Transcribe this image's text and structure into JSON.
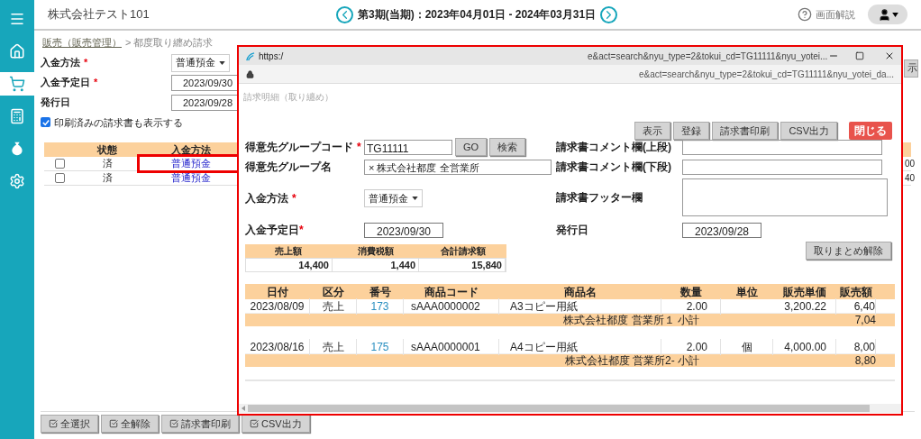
{
  "sidebar": {
    "items": [
      {
        "kind": "menu",
        "selected": false
      },
      {
        "kind": "home",
        "selected": false
      },
      {
        "kind": "cart",
        "selected": true
      },
      {
        "kind": "calculator",
        "selected": false
      },
      {
        "kind": "money",
        "selected": false
      },
      {
        "kind": "settings",
        "selected": false
      }
    ]
  },
  "header": {
    "company": "株式会社テスト101",
    "period": "第3期(当期)：2023年04月01日 - 2024年03月31日",
    "help": "画面解説"
  },
  "breadcrumb": {
    "link": "販売（販売管理）",
    "current": "> 都度取り纏め請求"
  },
  "required_mark": "*",
  "form": {
    "payment_required": true,
    "due_required": true,
    "payment_label": "入金方法",
    "payment_value": "普通預金",
    "due_label": "入金予定日",
    "due_value": "2023/09/30",
    "issue_label": "発行日",
    "issue_value": "2023/09/28",
    "show_printed": {
      "label": "印刷済みの請求書も表示する",
      "checked": true
    },
    "side_button": "示"
  },
  "list": {
    "columns": [
      "状態",
      "入金方法"
    ],
    "rows": [
      {
        "checked": false,
        "status": "済",
        "method": "普通預金",
        "highlighted": true,
        "column_4": "00"
      },
      {
        "checked": false,
        "status": "済",
        "method": "普通預金",
        "highlighted": false,
        "column_4": "40"
      }
    ]
  },
  "footer_buttons": [
    "全選択",
    "全解除",
    "請求書印刷",
    "CSV出力"
  ],
  "popup": {
    "title": "https:/",
    "title_url": "e&act=search&nyu_type=2&tokui_cd=TG11111&nyu_yotei...",
    "address": "e&act=search&nyu_type=2&tokui_cd=TG11111&nyu_yotei_da...",
    "heading": "請求明細（取り纏め）",
    "buttons": [
      {
        "label": "表示",
        "kind": "normal"
      },
      {
        "label": "登録",
        "kind": "normal"
      },
      {
        "label": "請求書印刷",
        "kind": "normal"
      },
      {
        "label": "CSV出力",
        "kind": "normal"
      },
      {
        "label": "閉じる",
        "kind": "danger"
      }
    ],
    "group_code_required": true,
    "payment_required": true,
    "due_required": true,
    "group_code_label": "得意先グループコード",
    "group_code_value": "TG11111",
    "go": "GO",
    "search": "検索",
    "group_name_label": "得意先グループ名",
    "group_name_value": "× 株式会社都度 全営業所",
    "payment_label": "入金方法",
    "payment_value": "普通預金",
    "due_label": "入金予定日",
    "due_value": "2023/09/30",
    "comment_top_label": "請求書コメント欄(上段)",
    "comment_bottom_label": "請求書コメント欄(下段)",
    "footer_label": "請求書フッター欄",
    "issue_label": "発行日",
    "issue_value": "2023/09/28",
    "unbundle": "取りまとめ解除",
    "summary": {
      "columns": [
        "売上額",
        "消費税額",
        "合計請求額"
      ],
      "values": [
        "14,400",
        "1,440",
        "15,840"
      ]
    },
    "detail": {
      "columns": [
        "日付",
        "区分",
        "番号",
        "商品コード",
        "商品名",
        "数量",
        "単位",
        "販売単価",
        "販売額"
      ],
      "groups": [
        {
          "item": {
            "date": "2023/08/09",
            "type": "売上",
            "number": "173",
            "code": "sAAA0000002",
            "name": "A3コピー用紙",
            "qty": "2.00",
            "price": "3,200.22",
            "amount": "6,40"
          },
          "subtotal": {
            "label": "株式会社都度 営業所１ 小計",
            "amount": "7,04"
          }
        },
        {
          "item": {
            "date": "2023/08/16",
            "type": "売上",
            "number": "175",
            "code": "sAAA0000001",
            "name": "A4コピー用紙",
            "qty": "2.00",
            "unit": "個",
            "price": "4,000.00",
            "amount": "8,00"
          },
          "subtotal": {
            "label": "株式会社都度 営業所2- 小計",
            "amount": "8,80"
          }
        }
      ]
    }
  }
}
